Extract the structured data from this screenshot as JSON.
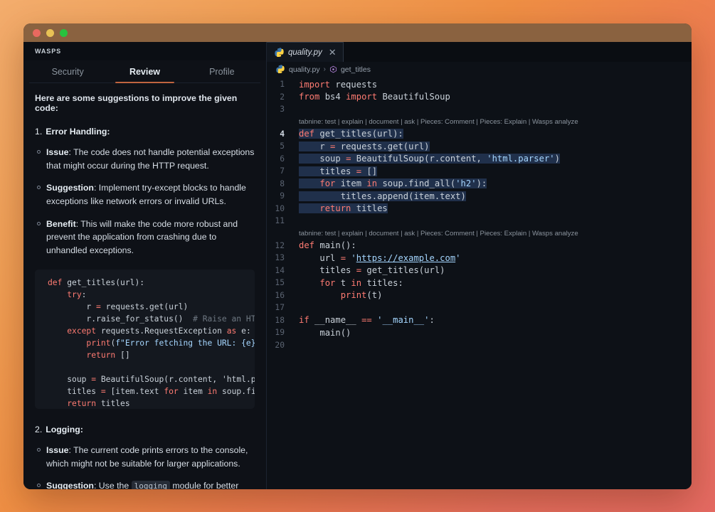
{
  "window": {
    "traffic_lights": [
      "close-red",
      "minimize-yellow",
      "maximize-green"
    ],
    "titlebar_color": "#8a6240",
    "background_gradient_from": "#f3ad6d",
    "background_gradient_to": "#e56a62"
  },
  "sidebar": {
    "title": "WASPS",
    "tabs": [
      {
        "label": "Security",
        "active": false
      },
      {
        "label": "Review",
        "active": true
      },
      {
        "label": "Profile",
        "active": false
      }
    ],
    "accent_color": "#c0643f",
    "intro": "Here are some suggestions to improve the given code:",
    "sections": [
      {
        "num": "1.",
        "name": "Error Handling:",
        "bullets": [
          {
            "label": "Issue",
            "text": ": The code does not handle potential exceptions that might occur during the HTTP request."
          },
          {
            "label": "Suggestion",
            "text": ": Implement try-except blocks to handle exceptions like network errors or invalid URLs."
          },
          {
            "label": "Benefit",
            "text": ": This will make the code more robust and prevent the application from crashing due to unhandled exceptions."
          }
        ]
      },
      {
        "num": "2.",
        "name": "Logging:",
        "bullets": [
          {
            "label": "Issue",
            "text": ": The current code prints errors to the console, which might not be suitable for larger applications."
          },
          {
            "label": "Suggestion",
            "text": ": Use the ",
            "code": "logging",
            "text2": " module for better error tracking and debugging."
          }
        ]
      }
    ],
    "code_snippet_lines": [
      "def get_titles(url):",
      "    try:",
      "        r = requests.get(url)",
      "        r.raise_for_status()  # Raise an HTTP",
      "    except requests.RequestException as e:",
      "        print(f\"Error fetching the URL: {e}\"",
      "        return []",
      "",
      "    soup = BeautifulSoup(r.content, 'html.pa",
      "    titles = [item.text for item in soup.fin",
      "    return titles"
    ]
  },
  "editor": {
    "tab": {
      "filename": "quality.py",
      "close_label": "✕",
      "icon": "python-icon"
    },
    "breadcrumb": {
      "file": "quality.py",
      "separator": "›",
      "symbol": "get_titles",
      "file_icon": "python-icon",
      "symbol_icon": "method-symbol-icon"
    },
    "codelens_text": "tabnine: test | explain | document | ask | Pieces: Comment | Pieces: Explain | Wasps analyze",
    "lines": [
      {
        "n": "1",
        "text": "import requests"
      },
      {
        "n": "2",
        "text": "from bs4 import BeautifulSoup"
      },
      {
        "n": "3",
        "text": ""
      },
      {
        "n": "codelens-1",
        "codelens": true
      },
      {
        "n": "4",
        "text": "def get_titles(url):",
        "selected": true,
        "active": true
      },
      {
        "n": "5",
        "text": "    r = requests.get(url)",
        "selected": true
      },
      {
        "n": "6",
        "text": "    soup = BeautifulSoup(r.content, 'html.parser')",
        "selected": true
      },
      {
        "n": "7",
        "text": "    titles = []",
        "selected": true
      },
      {
        "n": "8",
        "text": "    for item in soup.find_all('h2'):",
        "selected": true
      },
      {
        "n": "9",
        "text": "        titles.append(item.text)",
        "selected": true
      },
      {
        "n": "10",
        "text": "    return titles",
        "selected": true
      },
      {
        "n": "11",
        "text": ""
      },
      {
        "n": "codelens-2",
        "codelens": true
      },
      {
        "n": "12",
        "text": "def main():"
      },
      {
        "n": "13",
        "text": "    url = 'https://example.com'"
      },
      {
        "n": "14",
        "text": "    titles = get_titles(url)"
      },
      {
        "n": "15",
        "text": "    for t in titles:"
      },
      {
        "n": "16",
        "text": "        print(t)"
      },
      {
        "n": "17",
        "text": ""
      },
      {
        "n": "18",
        "text": "if __name__ == '__main__':"
      },
      {
        "n": "19",
        "text": "    main()"
      },
      {
        "n": "20",
        "text": ""
      }
    ]
  }
}
